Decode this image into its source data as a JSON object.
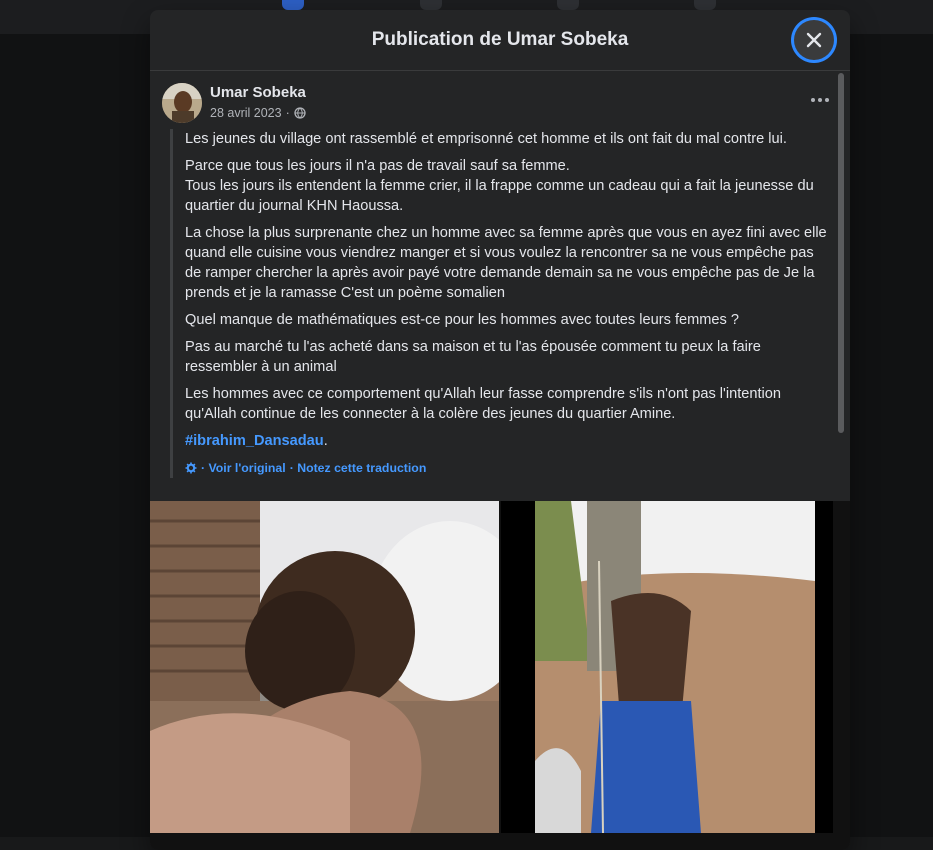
{
  "dialog": {
    "title": "Publication de Umar Sobeka",
    "close_icon": "close-icon"
  },
  "post": {
    "author": "Umar Sobeka",
    "date": "28 avril 2023",
    "separator": "·",
    "privacy_icon": "globe-icon",
    "more_icon": "more-horizontal-icon",
    "paragraphs": [
      "Les jeunes du village ont rassemblé et emprisonné cet homme et ils ont fait du mal contre lui.",
      "Parce que tous les jours il n'a pas de travail sauf sa femme.",
      "Tous les jours ils entendent la femme crier, il la frappe comme un cadeau qui a fait la jeunesse du quartier du journal KHN Haoussa.",
      "La chose la plus surprenante chez un homme avec sa femme après que vous en ayez fini avec elle quand elle cuisine vous viendrez manger et si vous voulez la rencontrer sa ne vous empêche pas de ramper chercher la après avoir payé votre demande demain sa ne vous empêche pas de Je la prends et je la ramasse C'est un poème somalien",
      "Quel manque de mathématiques est-ce pour les hommes avec toutes leurs femmes ?",
      "Pas au marché tu l'as acheté dans sa maison et tu l'as épousée comment tu peux la faire ressembler à un animal",
      "Les hommes avec ce comportement qu'Allah leur fasse comprendre s'ils n'ont pas l'intention qu'Allah continue de les connecter à la colère des jeunes du quartier Amine."
    ],
    "hashtag": "#ibrahim_Dansadau",
    "hashtag_suffix": ".",
    "translation": {
      "icon": "gear-icon",
      "view_original": "· Voir l'original",
      "rate": "· Notez cette traduction"
    }
  },
  "colors": {
    "dialog_bg": "#242526",
    "link": "#4599ff",
    "close_ring": "#2d88ff"
  }
}
